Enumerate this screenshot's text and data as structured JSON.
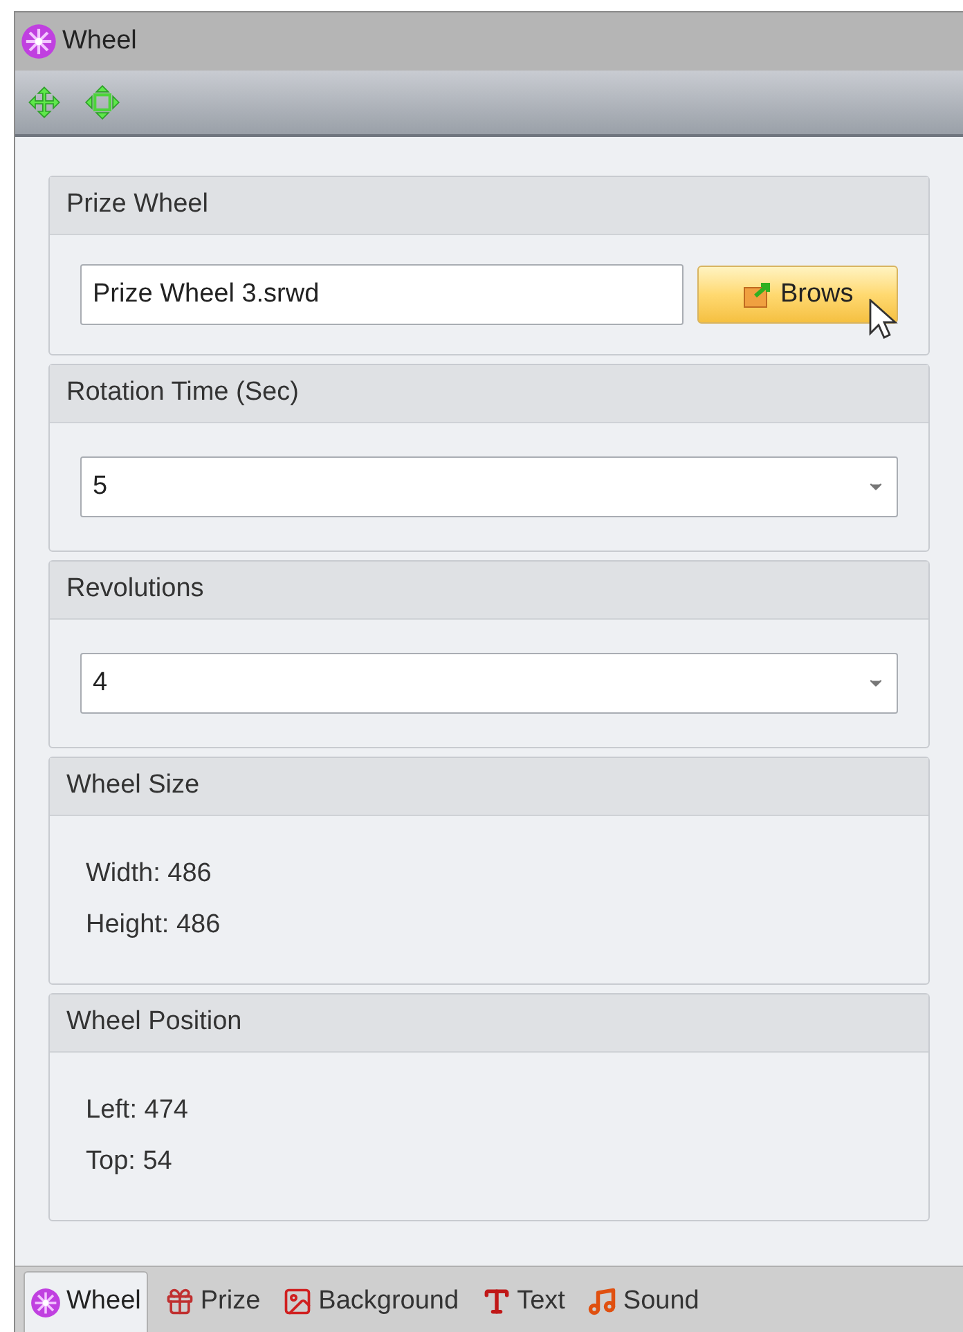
{
  "window": {
    "title": "Wheel"
  },
  "sections": [
    {
      "kind": "file",
      "title": "Prize Wheel",
      "value": "Prize Wheel 3.srwd",
      "button": "Brows"
    },
    {
      "kind": "dropdown",
      "title": "Rotation Time (Sec)",
      "value": "5"
    },
    {
      "kind": "dropdown",
      "title": "Revolutions",
      "value": "4"
    },
    {
      "kind": "readout",
      "title": "Wheel Size",
      "lines": [
        "Width: 486",
        "Height: 486"
      ]
    },
    {
      "kind": "readout",
      "title": "Wheel Position",
      "lines": [
        "Left: 474",
        "Top: 54"
      ]
    }
  ],
  "tabs": [
    {
      "label": "Wheel",
      "kind": "wheel",
      "selected": true
    },
    {
      "label": "Prize",
      "kind": "gift",
      "selected": false
    },
    {
      "label": "Background",
      "kind": "picture",
      "selected": false
    },
    {
      "label": "Text",
      "kind": "text",
      "selected": false
    },
    {
      "label": "Sound",
      "kind": "note",
      "selected": false
    }
  ]
}
